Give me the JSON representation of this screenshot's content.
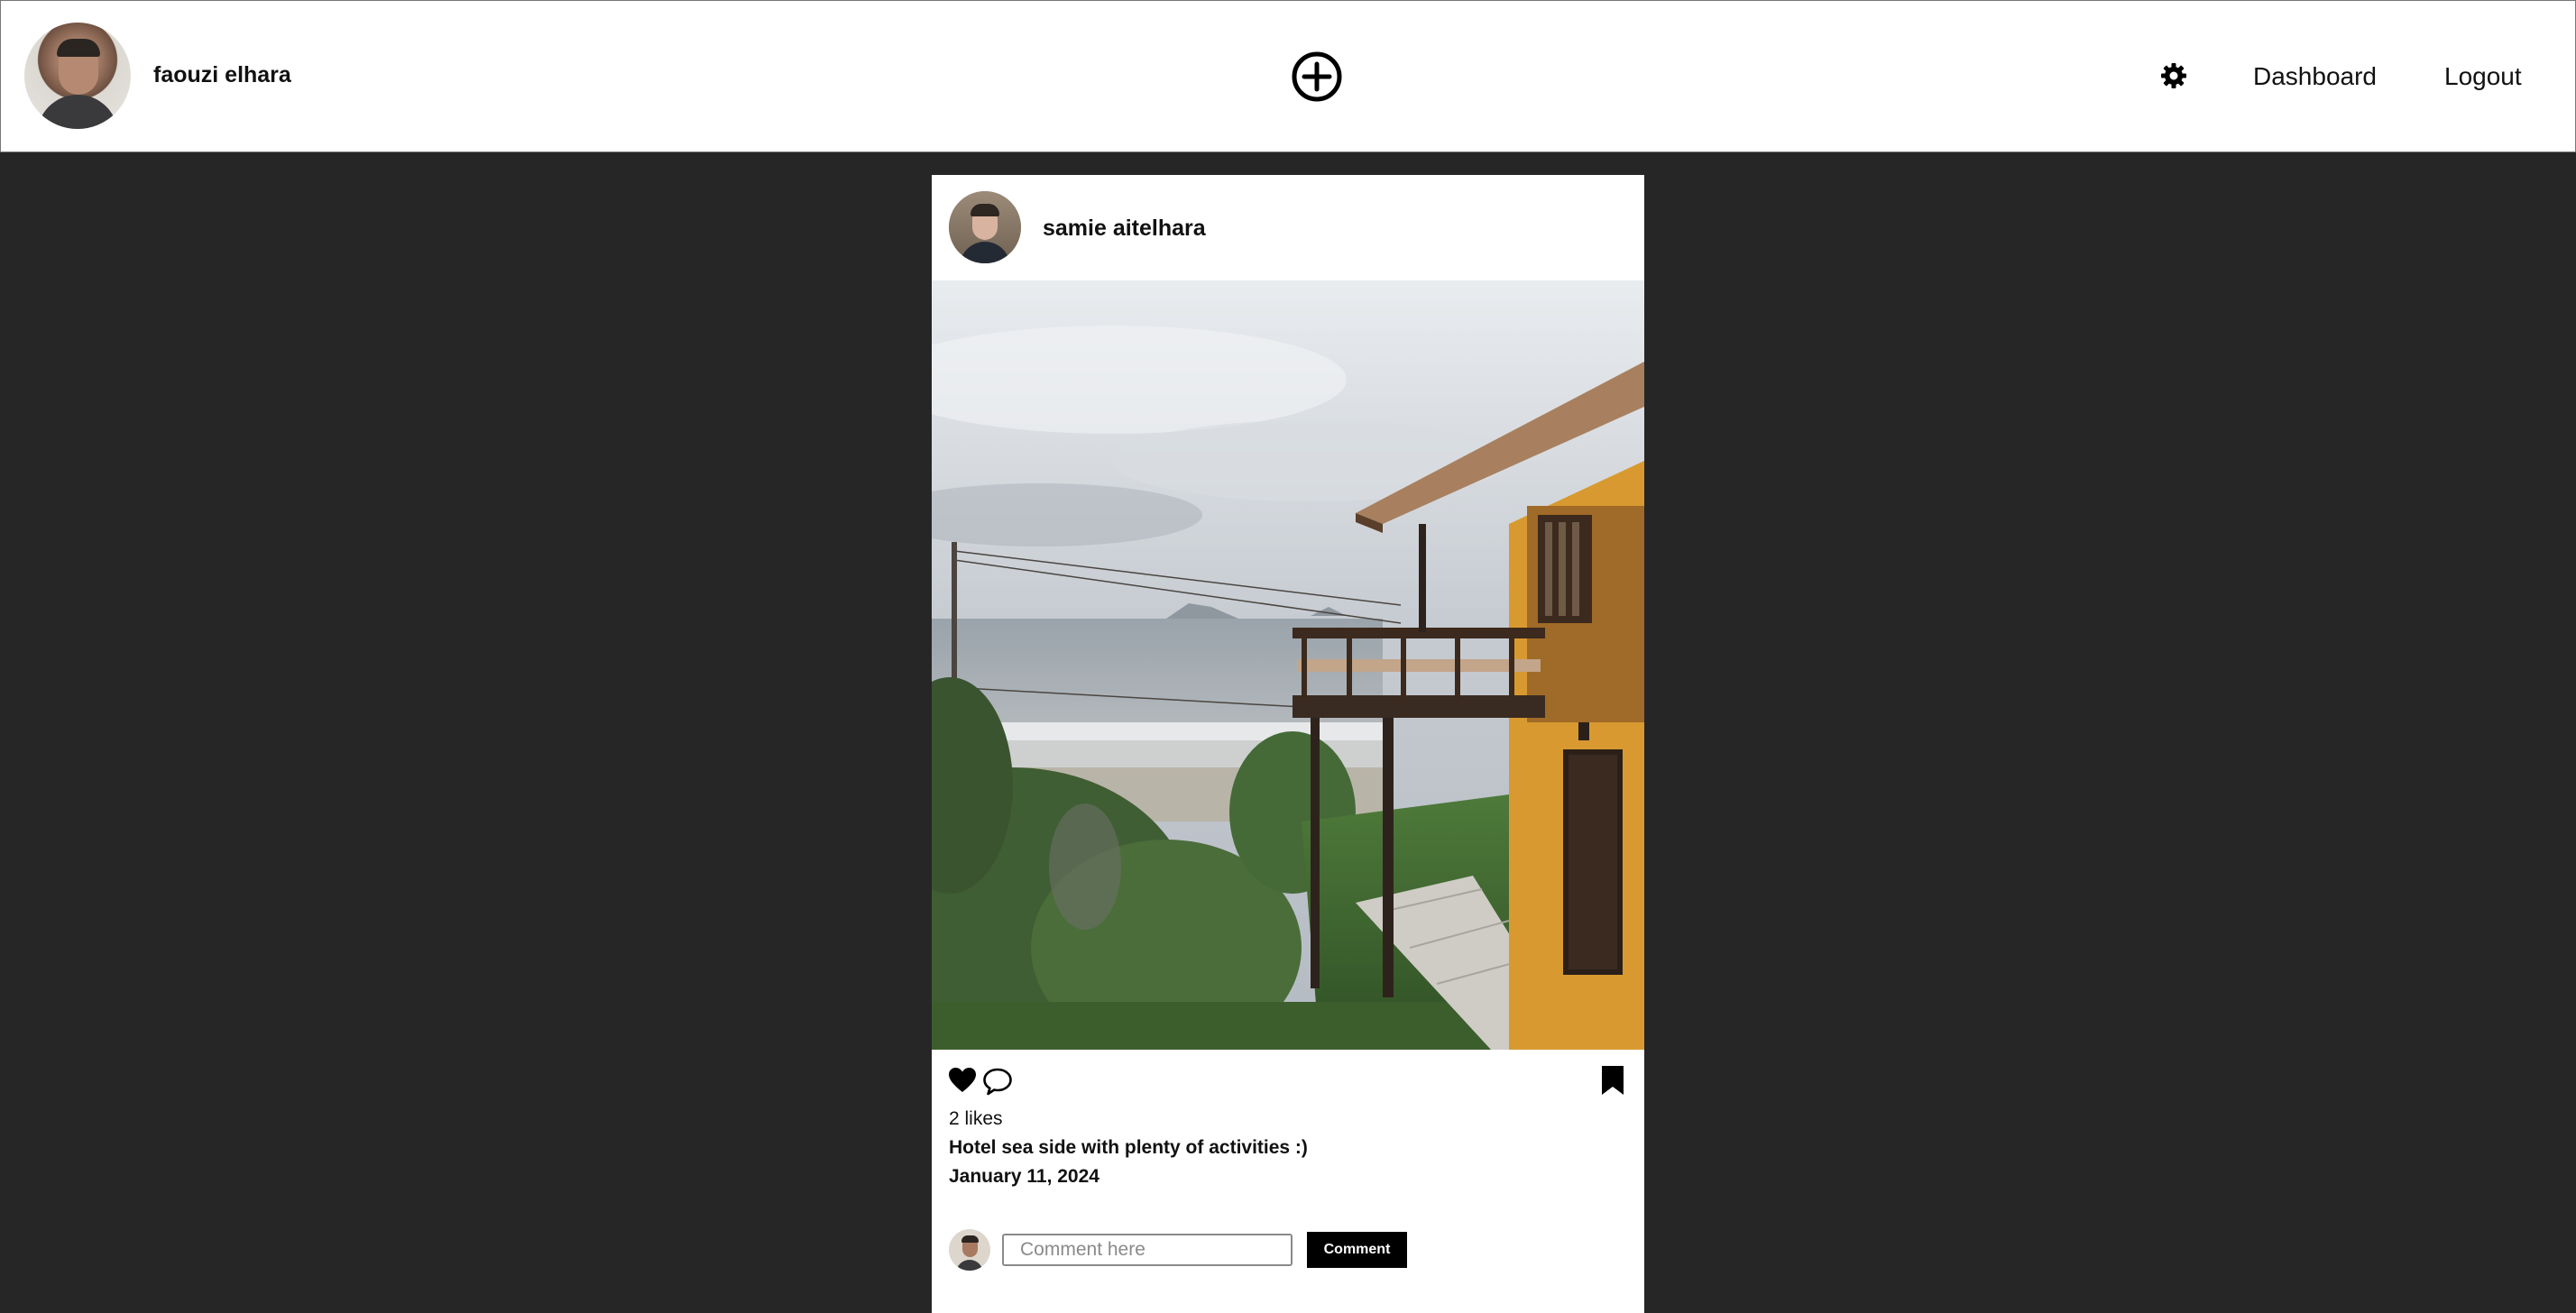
{
  "header": {
    "user_name": "faouzi elhara",
    "nav": {
      "dashboard_label": "Dashboard",
      "logout_label": "Logout"
    },
    "icons": [
      "avatar",
      "add-circle-icon",
      "gear-icon"
    ]
  },
  "post": {
    "author_name": "samie aitelhara",
    "likes_text": "2 likes",
    "caption": "Hotel sea side with plenty of activities :)",
    "date": "January 11, 2024",
    "icons": [
      "heart-icon",
      "comment-bubble-icon",
      "bookmark-icon"
    ],
    "comment": {
      "placeholder": "Comment here",
      "button_label": "Comment"
    }
  },
  "colors": {
    "page_background": "#262626",
    "card_background": "#ffffff",
    "button_background": "#000000"
  }
}
